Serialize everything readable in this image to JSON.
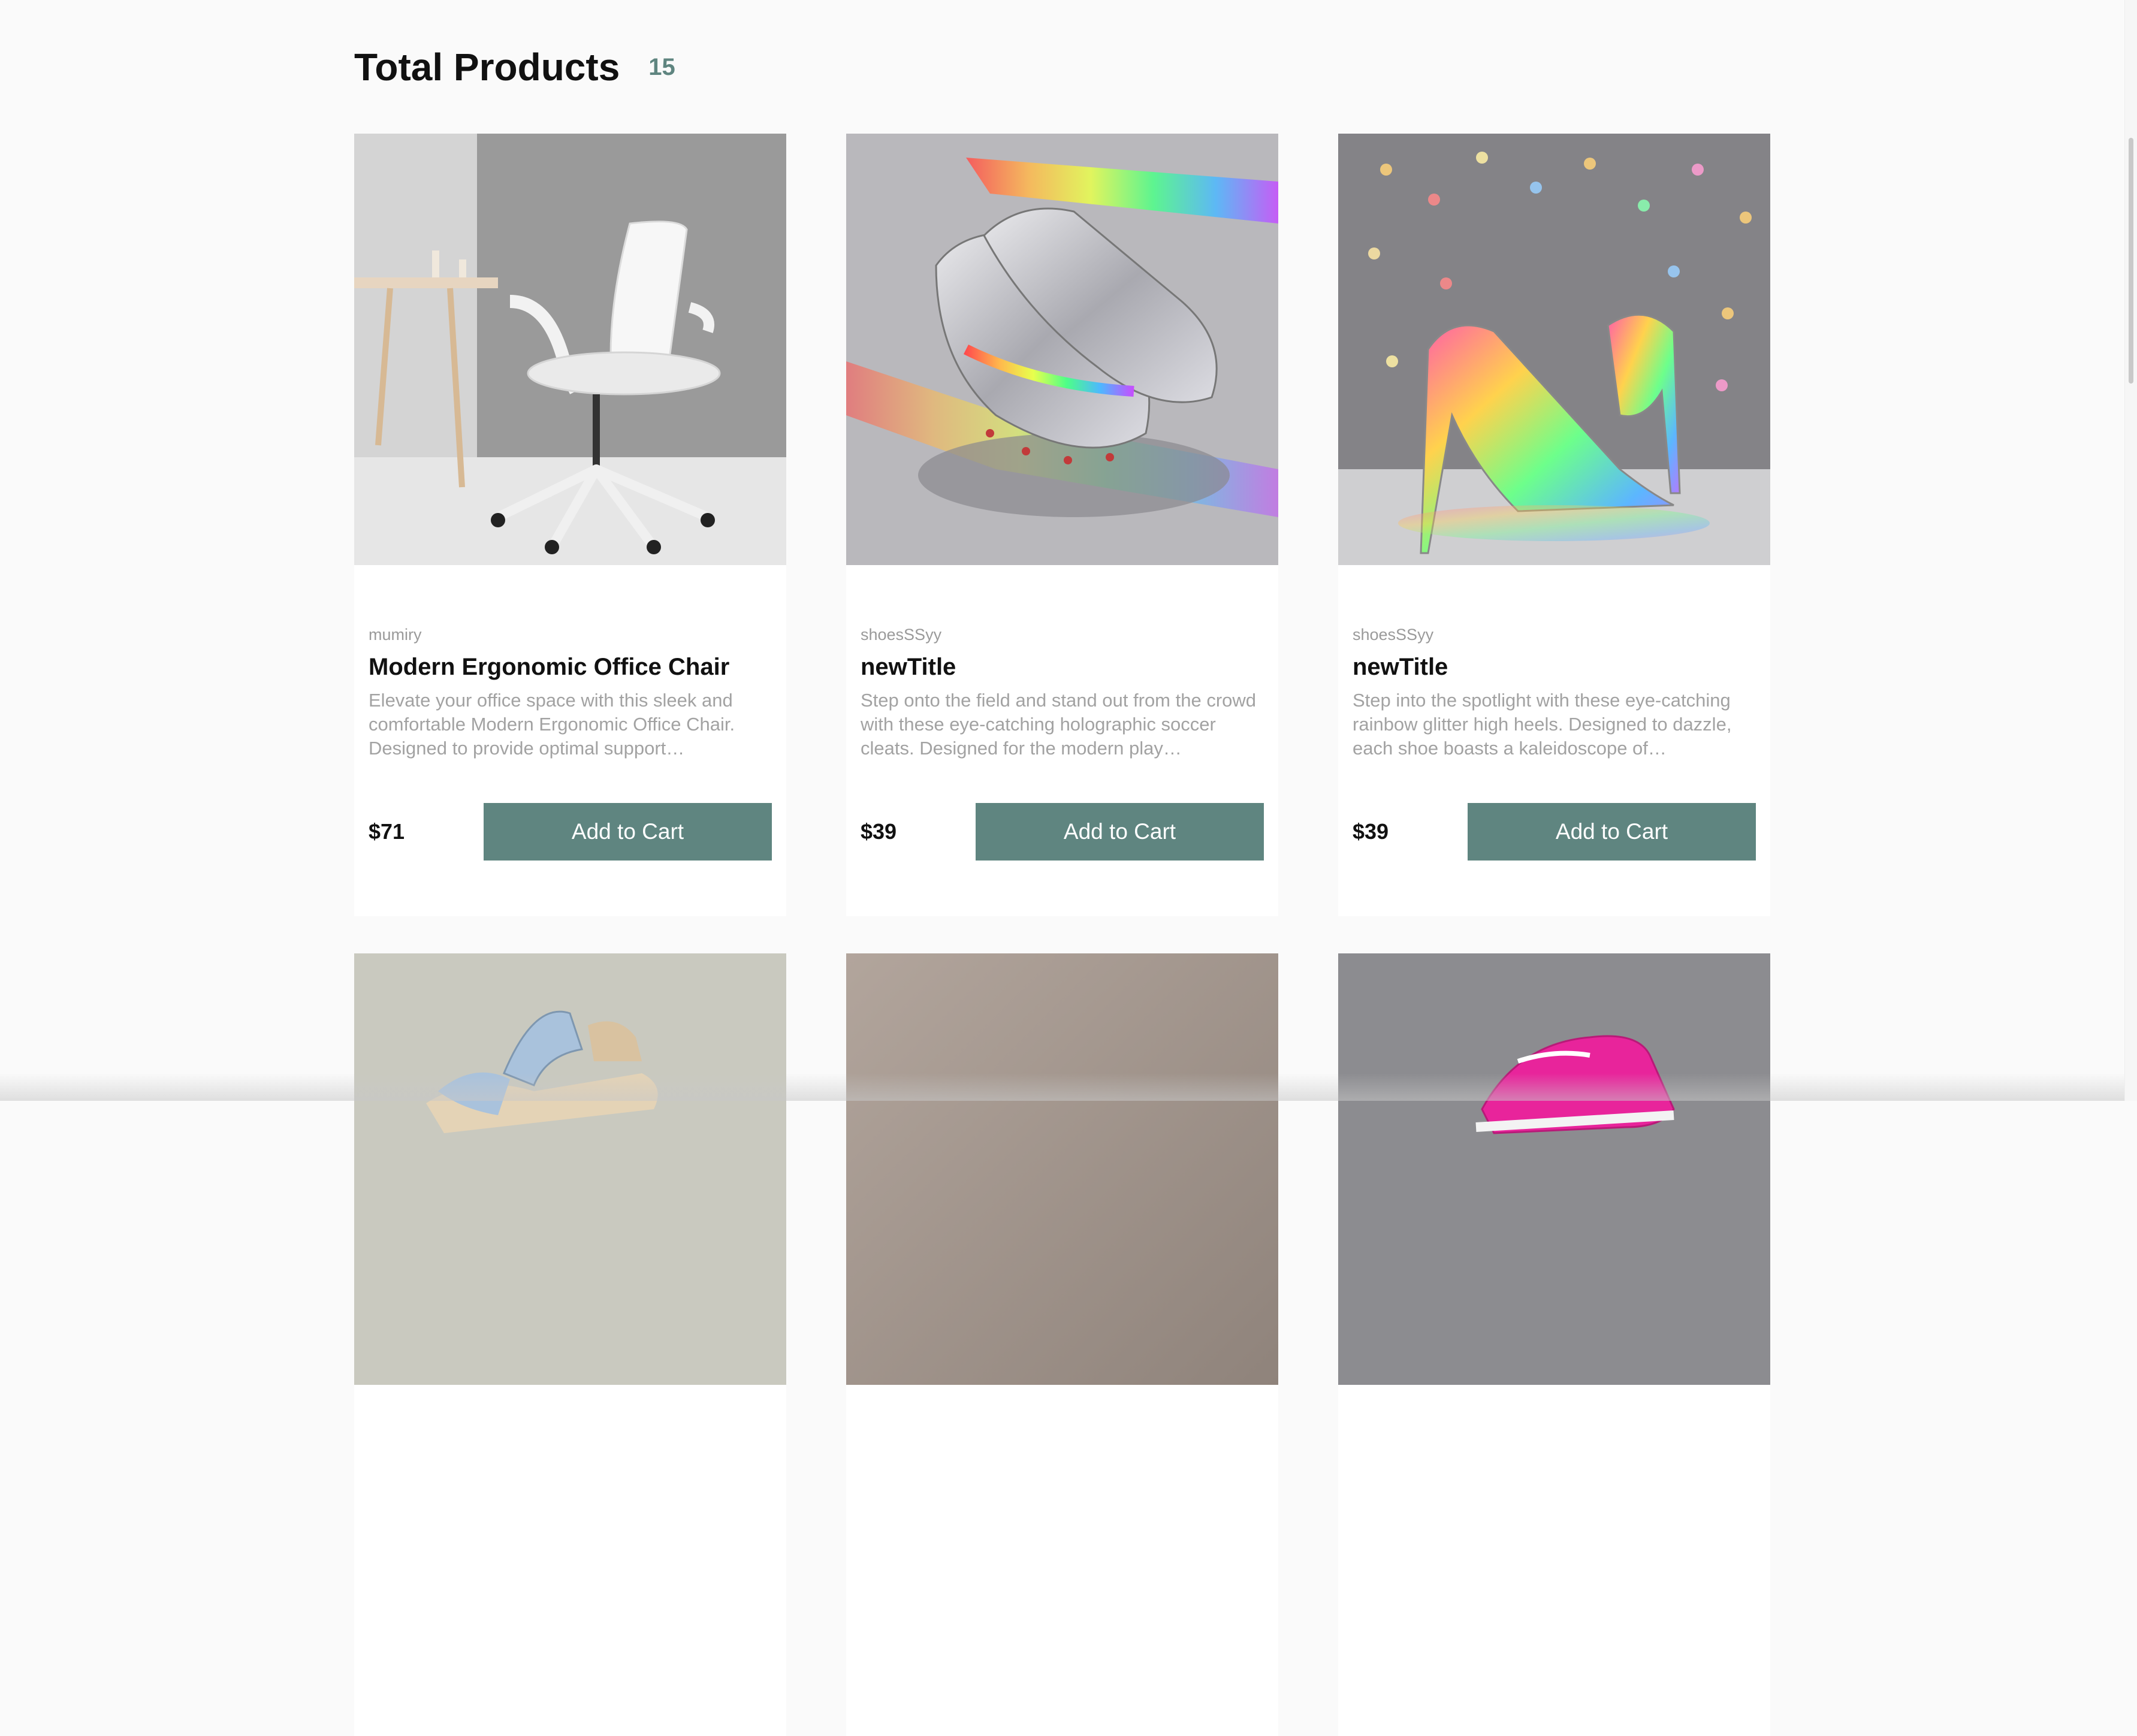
{
  "header": {
    "title": "Total Products",
    "count": "15"
  },
  "products": [
    {
      "brand": "mumiry",
      "title": "Modern Ergonomic Office Chair",
      "description": "Elevate your office space with this sleek and comfortable Modern Ergonomic Office Chair. Designed to provide optimal support…",
      "price": "$71",
      "button": "Add to Cart",
      "image": "office-chair"
    },
    {
      "brand": "shoesSSyy",
      "title": "newTitle",
      "description": "Step onto the field and stand out from the crowd with these eye-catching holographic soccer cleats. Designed for the modern play…",
      "price": "$39",
      "button": "Add to Cart",
      "image": "holographic-cleats"
    },
    {
      "brand": "shoesSSyy",
      "title": "newTitle",
      "description": "Step into the spotlight with these eye-catching rainbow glitter high heels. Designed to dazzle, each shoe boasts a kaleidoscope of…",
      "price": "$39",
      "button": "Add to Cart",
      "image": "glitter-heels"
    },
    {
      "image": "denim-sandal"
    },
    {
      "image": "taupe-product"
    },
    {
      "image": "pink-sneaker"
    }
  ],
  "colors": {
    "accent": "#5f8580",
    "background": "#fafafa"
  }
}
